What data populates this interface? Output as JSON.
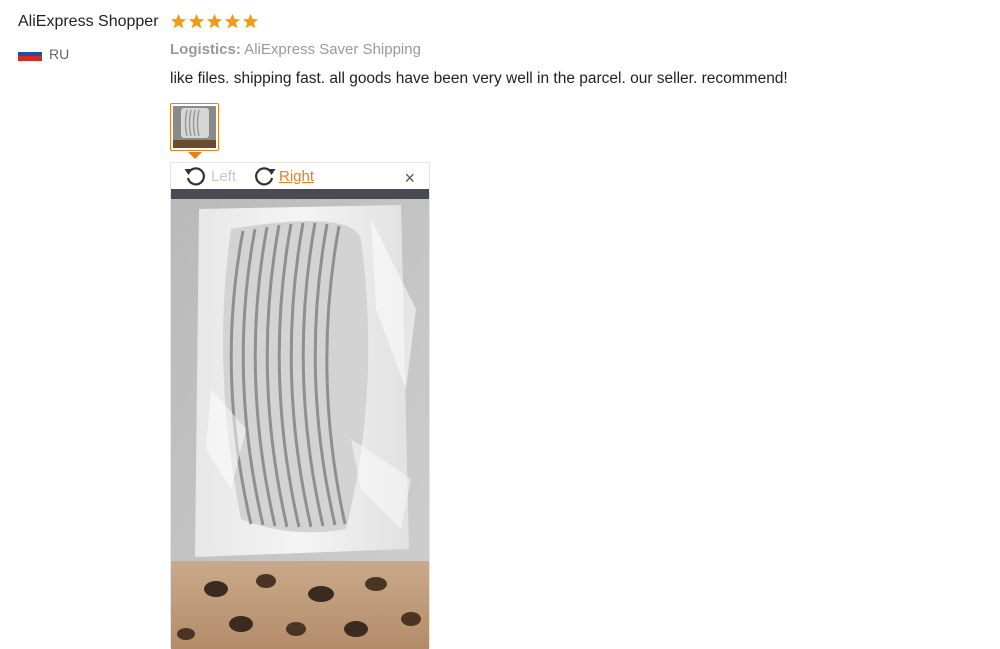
{
  "review": {
    "user_name": "AliExpress Shopper",
    "rating": 5,
    "rating_color": "#f39c12",
    "country_code": "RU",
    "flag_colors": [
      "#ffffff",
      "#1f4fa3",
      "#d52b1e"
    ],
    "logistics_label": "Logistics:",
    "logistics_value": " AliExpress Saver Shipping",
    "text": "like files. shipping fast. all goods have been very well in the parcel. our seller. recommend!"
  },
  "viewer": {
    "rotate_left_label": "Left",
    "rotate_right_label": "Right",
    "close_label": "×",
    "accent_color": "#e67e22"
  }
}
